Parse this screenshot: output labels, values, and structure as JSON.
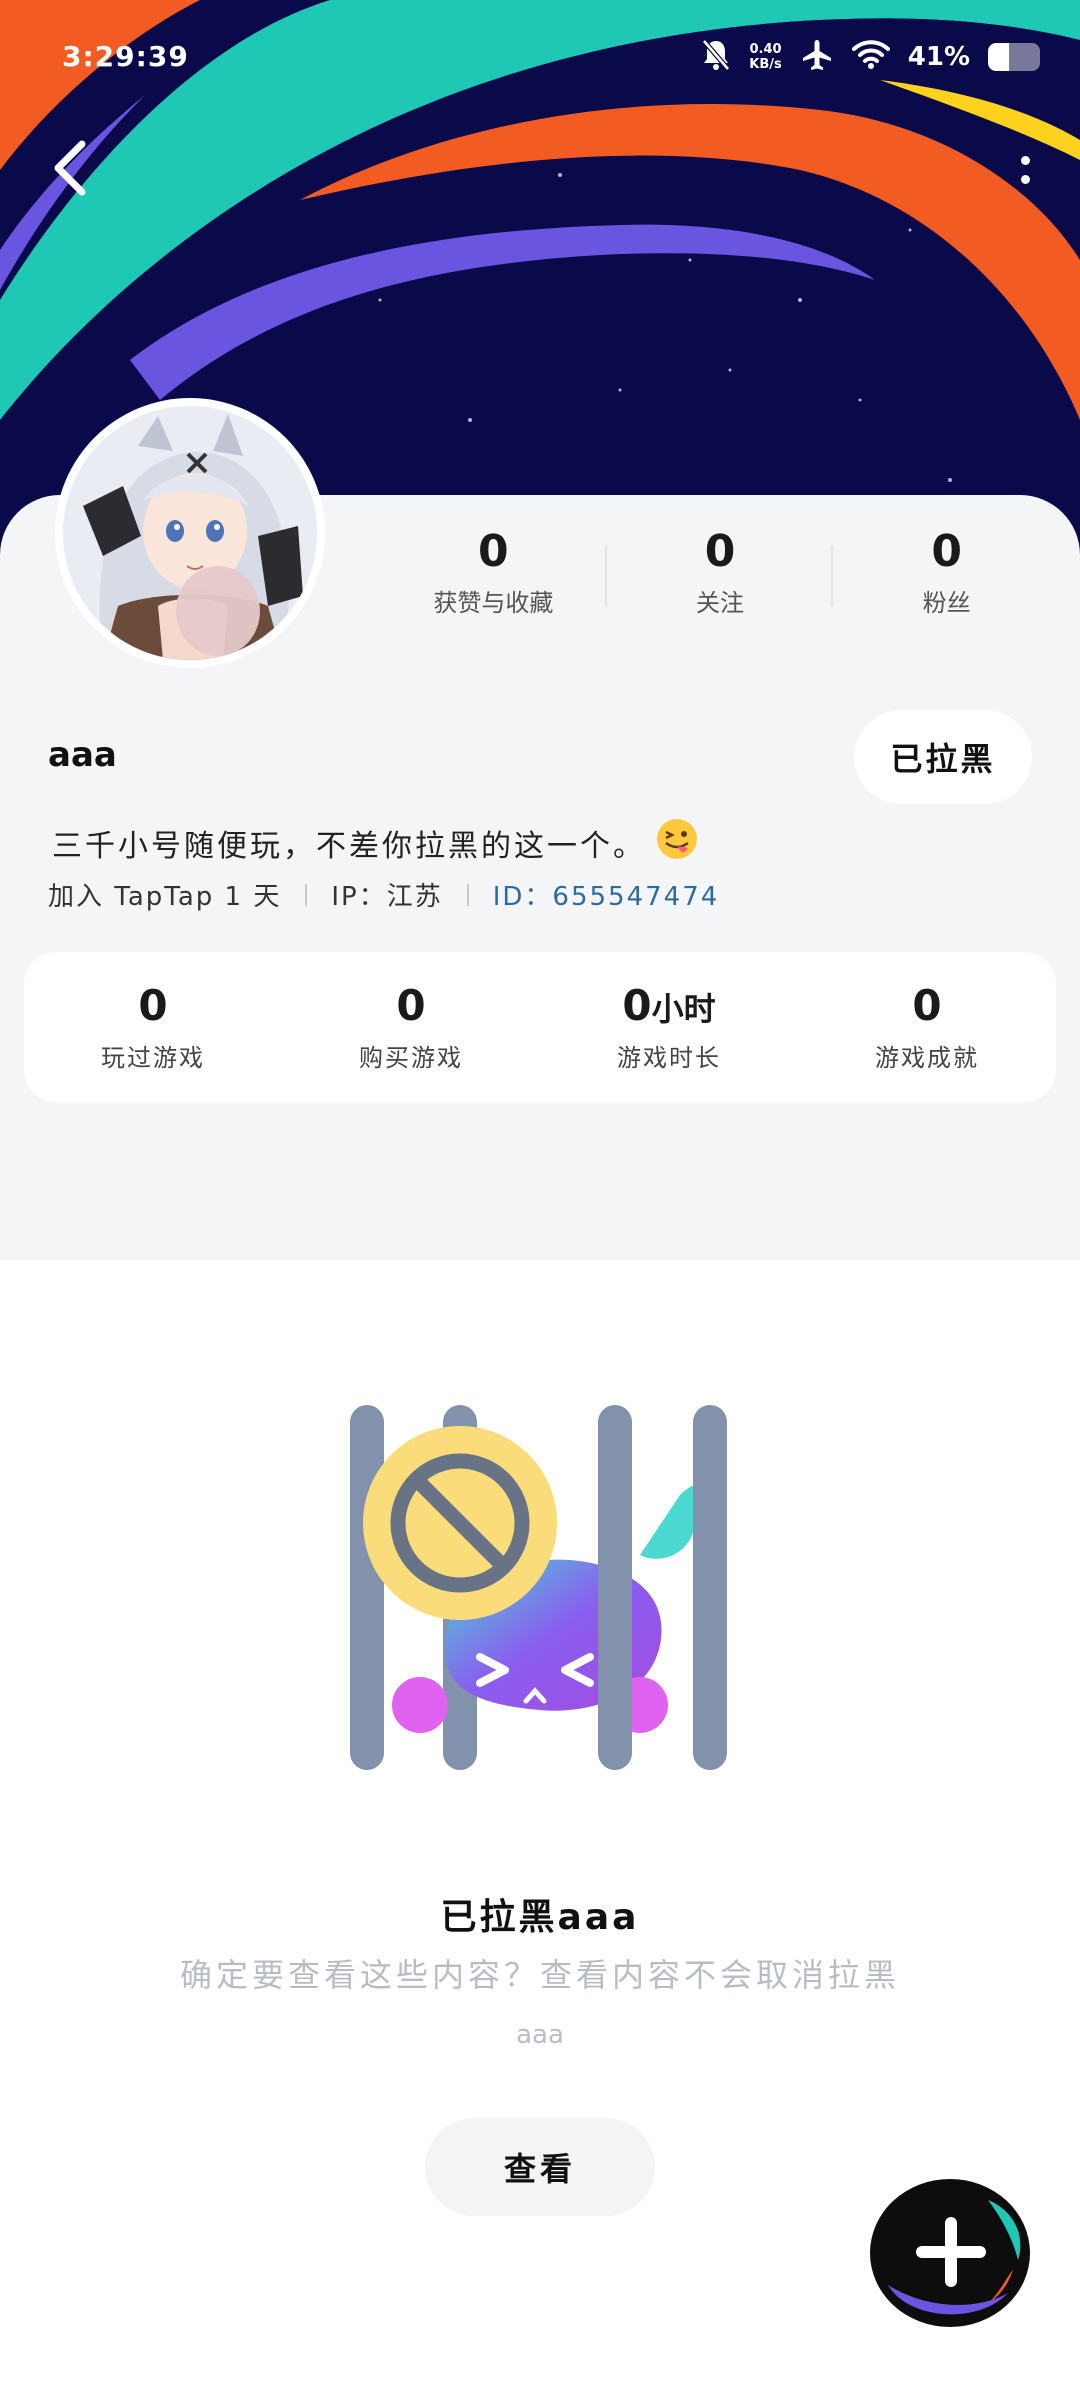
{
  "status_bar": {
    "time": "3:29:39",
    "net_speed_value": "0.40",
    "net_speed_unit": "KB/s",
    "battery_percent": "41%",
    "battery_level": 0.41
  },
  "profile": {
    "stats": [
      {
        "value": "0",
        "label": "获赞与收藏"
      },
      {
        "value": "0",
        "label": "关注"
      },
      {
        "value": "0",
        "label": "粉丝"
      }
    ],
    "username": "aaa",
    "blocked_button": "已拉黑",
    "bio": "三千小号随便玩，不差你拉黑的这一个。",
    "bio_emoji": "squinting-face-with-tongue",
    "joined": "加入 TapTap 1 天",
    "ip": "IP：江苏",
    "id": "ID：655547474"
  },
  "game_stats": [
    {
      "value": "0",
      "unit": "",
      "label": "玩过游戏"
    },
    {
      "value": "0",
      "unit": "",
      "label": "购买游戏"
    },
    {
      "value": "0",
      "unit": "小时",
      "label": "游戏时长"
    },
    {
      "value": "0",
      "unit": "",
      "label": "游戏成就"
    }
  ],
  "blocked_notice": {
    "title": "已拉黑aaa",
    "description": "确定要查看这些内容？查看内容不会取消拉黑",
    "description_name": "aaa",
    "view_button": "查看"
  },
  "colors": {
    "banner_bg": "#0a0a4a",
    "stripe_orange": "#f25c23",
    "stripe_teal": "#1fc7b5",
    "stripe_purple": "#6a55e0",
    "accent_id": "#2d6aa0"
  }
}
